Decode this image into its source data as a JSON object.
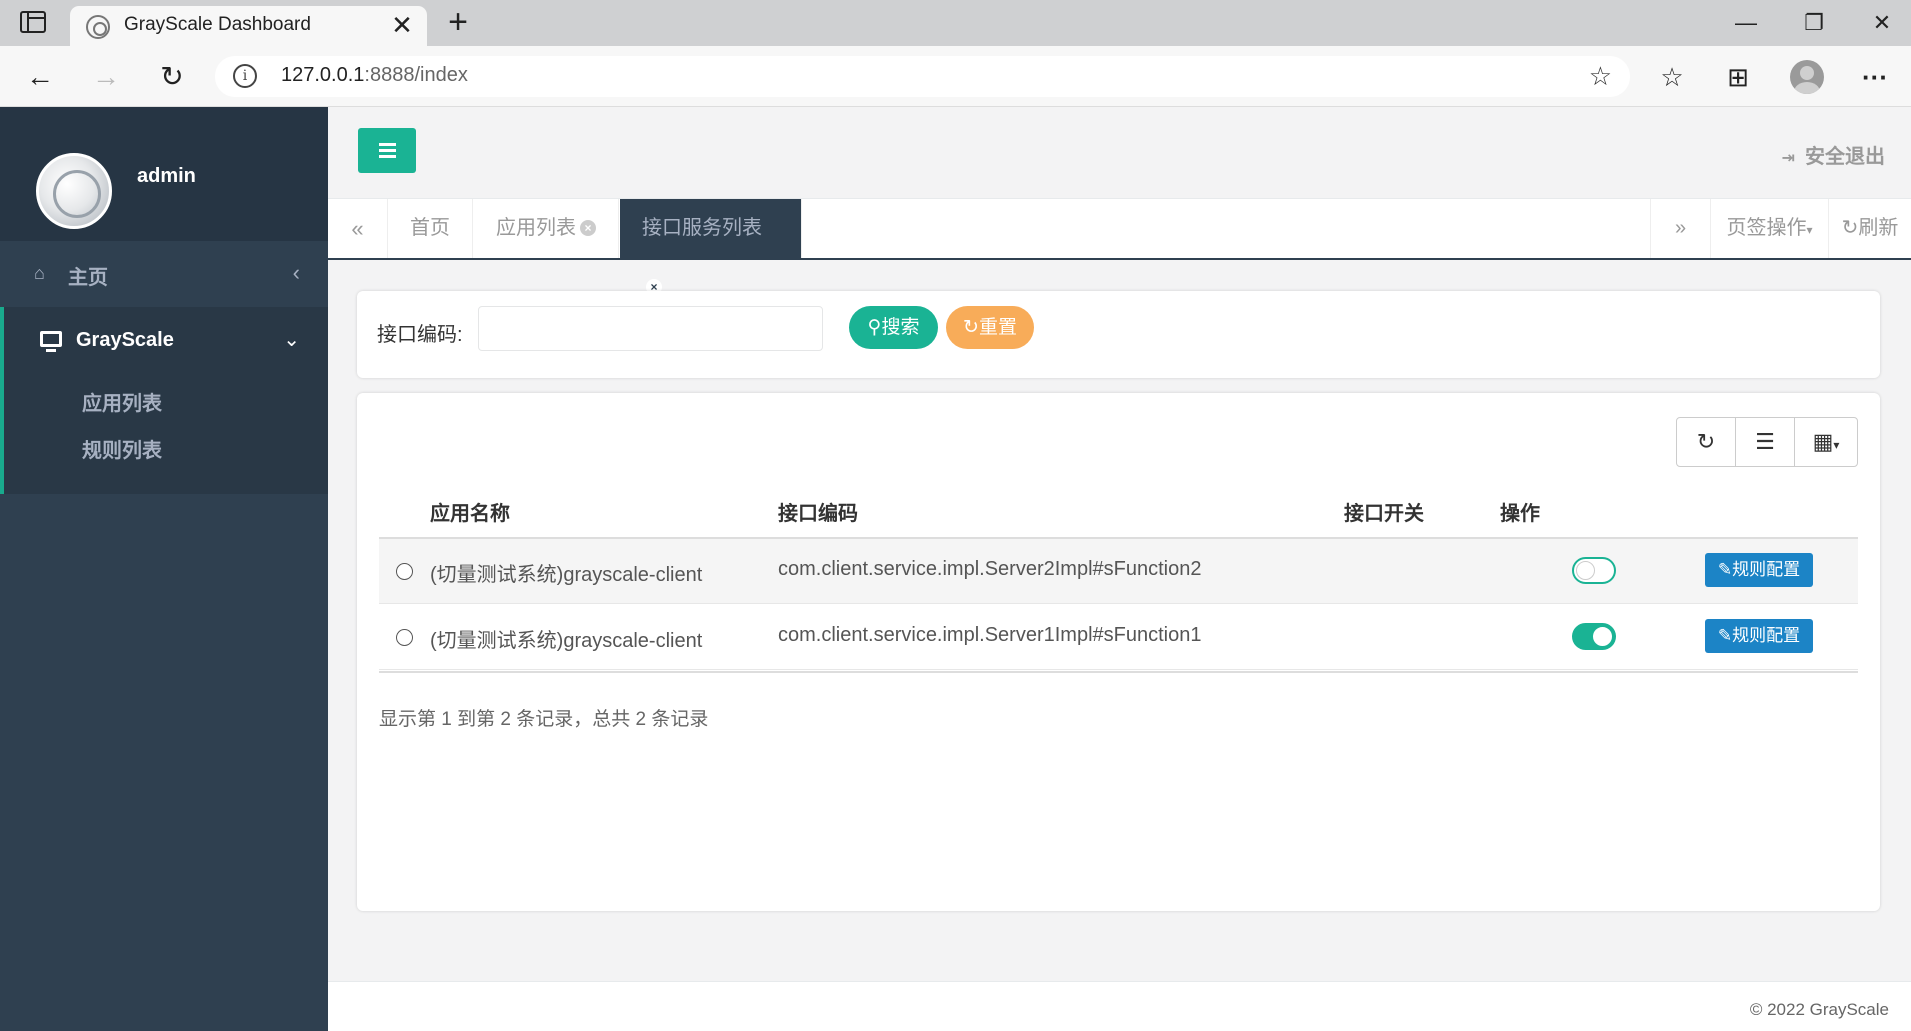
{
  "browser": {
    "tab_title": "GrayScale Dashboard",
    "tab_close": "✕",
    "new_tab": "+",
    "url_host": "127.0.0.1",
    "url_rest": ":8888/index",
    "window_controls": {
      "minimize": "—",
      "restore": "❐",
      "close": "✕"
    },
    "nav": {
      "back": "←",
      "forward": "→",
      "reload": "↻"
    },
    "toolbar": {
      "favorites": "☆",
      "collections": "⊞",
      "more": "···"
    }
  },
  "sidebar": {
    "username": "admin",
    "home_label": "主页",
    "home_icon": "home-icon",
    "active_group": "GrayScale",
    "active_icon": "desktop-icon",
    "sub_items": [
      "应用列表",
      "规则列表"
    ]
  },
  "topnav": {
    "logout_label": "安全退出",
    "logout_icon": "sign-out-icon"
  },
  "page_tabs": {
    "items": [
      {
        "label": "首页",
        "closable": false,
        "active": false
      },
      {
        "label": "应用列表",
        "closable": true,
        "active": false
      },
      {
        "label": "接口服务列表",
        "closable": true,
        "active": true
      }
    ],
    "tab_ops_label": "页签操作",
    "refresh_label": "刷新"
  },
  "search": {
    "label": "接口编码:",
    "value": "",
    "search_button": "搜索",
    "reset_button": "重置"
  },
  "table": {
    "toolbar": [
      "refresh-icon",
      "list-icon",
      "columns-icon"
    ],
    "columns": [
      "应用名称",
      "接口编码",
      "接口开关",
      "操作"
    ],
    "rows": [
      {
        "app": "(切量测试系统)grayscale-client",
        "code": "com.client.service.impl.Server2Impl#sFunction2",
        "switch_on": false,
        "action": "规则配置"
      },
      {
        "app": "(切量测试系统)grayscale-client",
        "code": "com.client.service.impl.Server1Impl#sFunction1",
        "switch_on": true,
        "action": "规则配置"
      }
    ],
    "pagination_info": "显示第 1 到第 2 条记录，总共 2 条记录"
  },
  "footer": {
    "text": "© 2022 GrayScale"
  },
  "colors": {
    "sidebar": "#2f4050",
    "primary": "#1ab394",
    "warning": "#f8ac59",
    "info": "#1c84c6"
  }
}
